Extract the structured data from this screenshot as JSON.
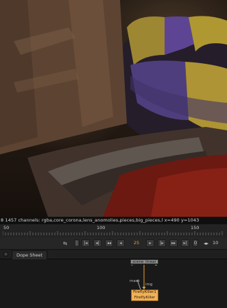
{
  "viewer": {
    "info": "8 1457 channels: rgba,core_corona,lens_anomolies,pieces,big_pieces,l  x=490 y=1043"
  },
  "timeline": {
    "tick_labels": [
      "50",
      "100",
      "150"
    ]
  },
  "transport": {
    "current_frame": "25",
    "increment": "10",
    "buttons": [
      "|",
      "|◂",
      "◂|",
      "◂◂",
      "◂",
      "▸",
      "|▸",
      "▸▸",
      "▸|",
      "O"
    ]
  },
  "tabs": {
    "dope_sheet": "Dope Sheet"
  },
  "graph": {
    "read_node": "scene_linear",
    "edge_label_mask": "mask",
    "edge_label_img": "img",
    "firefly_line1": "FireflyKiller1",
    "firefly_line2": "FireflyKiller"
  },
  "colors": {
    "accent": "#e8a33a",
    "node_firefly": "#f0b057",
    "ring_yellow": "#d4b33a",
    "ring_purple": "#6a4fa8"
  }
}
